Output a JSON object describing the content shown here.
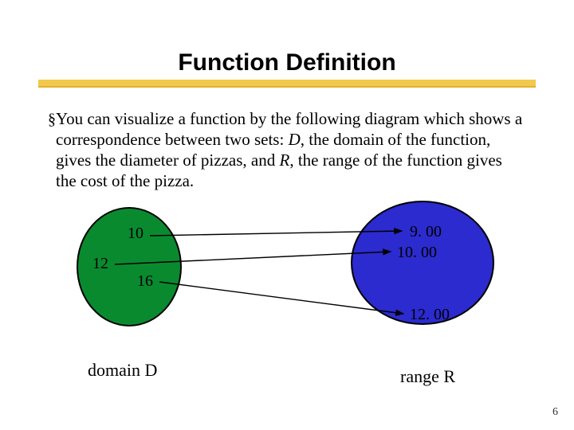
{
  "title": "Function Definition",
  "bullet": "§",
  "paragraph_html": "You can visualize a function by the following diagram which shows a correspondence between two sets: <span class=\"em\">D</span>, the domain of the function, gives the diameter of pizzas,  and <span class=\"em\">R</span>, the range of the function gives the cost of the pizza.",
  "domain": {
    "values": [
      "10",
      "12",
      "16"
    ],
    "caption_pre": "domain ",
    "caption_var": "D"
  },
  "range": {
    "values": [
      "9. 00",
      "10. 00",
      "12. 00"
    ],
    "caption_pre": "range ",
    "caption_var": "R"
  },
  "slide_number": "6",
  "chart_data": {
    "type": "diagram",
    "title": "Function Definition",
    "mapping": [
      {
        "from": "10",
        "to": "9. 00"
      },
      {
        "from": "12",
        "to": "10. 00"
      },
      {
        "from": "16",
        "to": "12. 00"
      }
    ],
    "sets": {
      "domain": "D",
      "range": "R"
    }
  }
}
